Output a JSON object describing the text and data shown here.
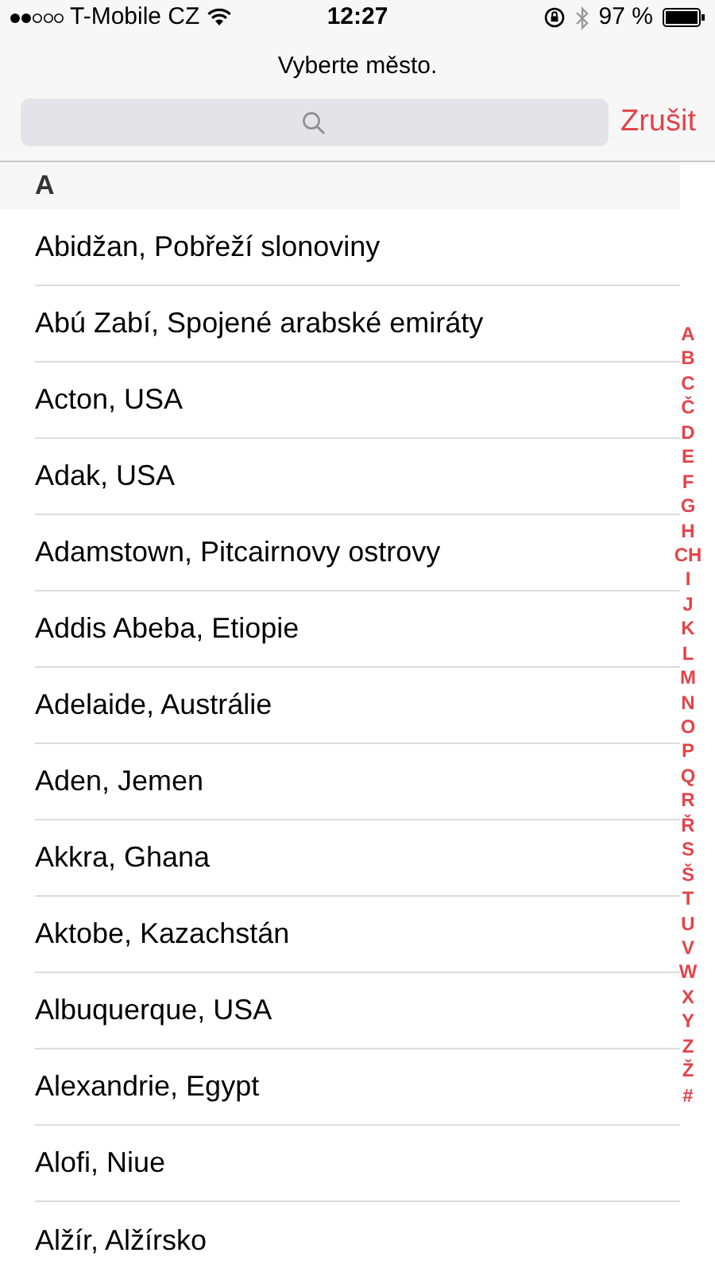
{
  "status_bar": {
    "carrier": "T-Mobile CZ",
    "time": "12:27",
    "battery": "97 %"
  },
  "header": {
    "title": "Vyberte město.",
    "cancel": "Zrušit"
  },
  "sections": [
    {
      "letter": "A",
      "cities": [
        "Abidžan, Pobřeží slonoviny",
        "Abú Zabí, Spojené arabské emiráty",
        "Acton, USA",
        "Adak, USA",
        "Adamstown, Pitcairnovy ostrovy",
        "Addis Abeba, Etiopie",
        "Adelaide, Austrálie",
        "Aden, Jemen",
        "Akkra, Ghana",
        "Aktobe, Kazachstán",
        "Albuquerque, USA",
        "Alexandrie, Egypt",
        "Alofi, Niue",
        "Alžír, Alžírsko"
      ]
    }
  ],
  "index": [
    "A",
    "B",
    "C",
    "Č",
    "D",
    "E",
    "F",
    "G",
    "H",
    "CH",
    "I",
    "J",
    "K",
    "L",
    "M",
    "N",
    "O",
    "P",
    "Q",
    "R",
    "Ř",
    "S",
    "Š",
    "T",
    "U",
    "V",
    "W",
    "X",
    "Y",
    "Z",
    "Ž",
    "#"
  ]
}
